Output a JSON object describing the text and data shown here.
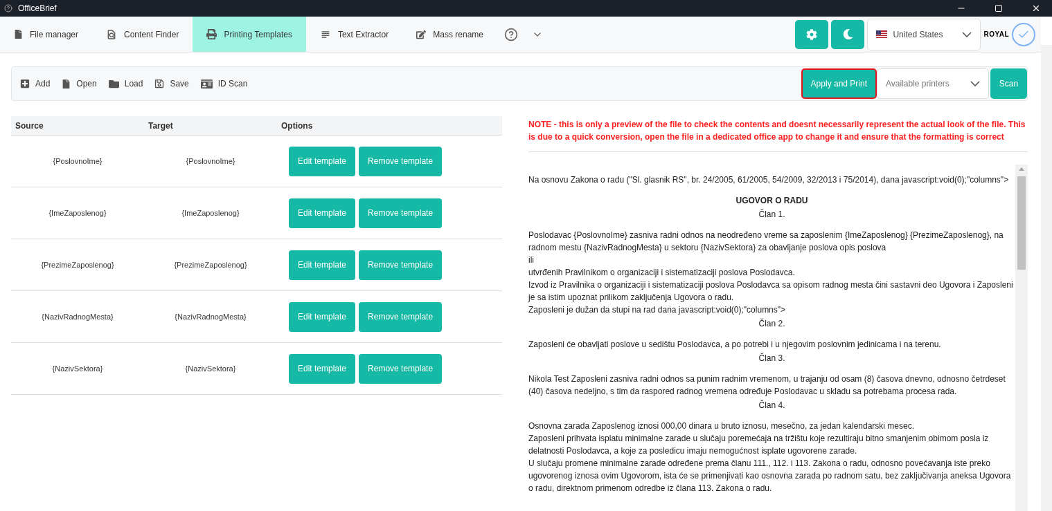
{
  "window": {
    "title": "OfficeBrief"
  },
  "nav": {
    "tabs": [
      {
        "label": "File manager",
        "selected": false
      },
      {
        "label": "Content Finder",
        "selected": false
      },
      {
        "label": "Printing Templates",
        "selected": true
      },
      {
        "label": "Text Extractor",
        "selected": false
      },
      {
        "label": "Mass rename",
        "selected": false
      }
    ],
    "country": "United States",
    "brand": "ROYAL"
  },
  "toolbar": {
    "actions": [
      "Add",
      "Open",
      "Load",
      "Save",
      "ID Scan"
    ],
    "apply_button": "Apply and Print",
    "printer_placeholder": "Available printers",
    "scan_button": "Scan"
  },
  "table": {
    "columns": [
      "Source",
      "Target",
      "Options"
    ],
    "rows": [
      {
        "source": "{PoslovnoIme}",
        "target": "{PoslovnoIme}",
        "edit": "Edit template",
        "remove": "Remove template"
      },
      {
        "source": "{ImeZaposlenog}",
        "target": "{ImeZaposlenog}",
        "edit": "Edit template",
        "remove": "Remove template"
      },
      {
        "source": "{PrezimeZaposlenog}",
        "target": "{PrezimeZaposlenog}",
        "edit": "Edit template",
        "remove": "Remove template"
      },
      {
        "source": "{NazivRadnogMesta}",
        "target": "{NazivRadnogMesta}",
        "edit": "Edit template",
        "remove": "Remove template"
      },
      {
        "source": "{NazivSektora}",
        "target": "{NazivSektora}",
        "edit": "Edit template",
        "remove": "Remove template"
      }
    ]
  },
  "note": "NOTE - this is only a preview of the file to check the contents and doesnt necessarily represent the actual look of the file. This is due to a quick conversion, open the file in a dedicated office app to change it and ensure that the formatting is correct",
  "document": [
    {
      "kind": "para",
      "text": "Na osnovu Zakona o radu (\"Sl. glasnik RS\", br. 24/2005, 61/2005, 54/2009, 32/2013 i 75/2014), dana javascript:void(0);\"columns\">"
    },
    {
      "kind": "title",
      "text": "UGOVOR O RADU"
    },
    {
      "kind": "article",
      "text": "Član 1."
    },
    {
      "kind": "para",
      "text": "Poslodavac {PoslovnoIme} zasniva radni odnos na neodređeno vreme sa zaposlenim {ImeZaposlenog} {PrezimeZaposlenog}, na radnom mestu {NazivRadnogMesta} u sektoru {NazivSektora} za obavljanje poslova opis poslova"
    },
    {
      "kind": "line",
      "text": "ili"
    },
    {
      "kind": "line",
      "text": "utvrđenih Pravilnikom o organizaciji i sistematizaciji poslova Poslodavca."
    },
    {
      "kind": "line",
      "text": "Izvod iz Pravilnika o organizaciji i sistematizaciji poslova Poslodavca sa opisom radnog mesta čini sastavni deo Ugovora i Zaposleni je sa istim upoznat prilikom zaključenja Ugovora o radu."
    },
    {
      "kind": "line",
      "text": "Zaposleni je dužan da stupi na rad dana javascript:void(0);\"columns\">"
    },
    {
      "kind": "article",
      "text": "Član 2."
    },
    {
      "kind": "para",
      "text": "Zaposleni će obavljati poslove u sedištu Poslodavca, a po potrebi i u njegovim poslovnim jedinicama i na terenu."
    },
    {
      "kind": "article",
      "text": "Član 3."
    },
    {
      "kind": "para",
      "text": "Nikola Test Zaposleni zasniva radni odnos sa punim radnim vremenom, u trajanju od osam (8) časova dnevno, odnosno četrdeset (40) časova nedeljno, s tim da raspored radnog vremena određuje Poslodavac u skladu sa potrebama procesa rada."
    },
    {
      "kind": "article",
      "text": "Član 4."
    },
    {
      "kind": "para",
      "text": "Osnovna zarada Zaposlenog iznosi 000,00 dinara u bruto iznosu, mesečno, za jedan kalendarski mesec."
    },
    {
      "kind": "line",
      "text": "Zaposleni prihvata isplatu minimalne zarade u slučaju poremećaja na tržištu koje rezultiraju bitno smanjenim obimom posla iz delatnosti Poslodavca, a koje za posledicu imaju nemogućnost isplate ugovorene zarade."
    },
    {
      "kind": "line",
      "text": "U slučaju promene minimalne zarade određene prema članu 111., 112. i 113. Zakona o radu, odnosno povećavanja iste preko ugovorenog iznosa ovim Ugovorom, ista će se primenjivati kao osnovna zarada po radnom satu, bez zaključivanja aneksa Ugovora o radu, direktnom primenom odredbe iz člana 113. Zakona o radu."
    }
  ]
}
